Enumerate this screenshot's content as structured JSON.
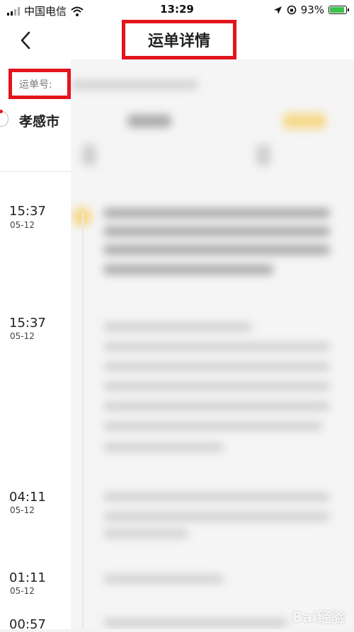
{
  "status_bar": {
    "carrier": "中国电信",
    "time": "13:29",
    "battery": "93%",
    "battery_level": 0.93,
    "icons": [
      "signal-icon",
      "wifi-icon",
      "location-icon",
      "rotation-lock-icon",
      "battery-icon"
    ]
  },
  "nav": {
    "back_icon": "chevron-left-icon",
    "title": "运单详情"
  },
  "waybill": {
    "label": "运单号:"
  },
  "route": {
    "from_city": "孝感市"
  },
  "timeline": [
    {
      "time": "15:37",
      "date": "05-12"
    },
    {
      "time": "15:37",
      "date": "05-12"
    },
    {
      "time": "04:11",
      "date": "05-12"
    },
    {
      "time": "01:11",
      "date": "05-12"
    },
    {
      "time": "00:57",
      "date": ""
    }
  ],
  "watermark": {
    "text": "Bai经验"
  },
  "colors": {
    "highlight_red": "#e3141c",
    "accent_yellow": "#f6d98a",
    "background": "#f3f3f3"
  }
}
